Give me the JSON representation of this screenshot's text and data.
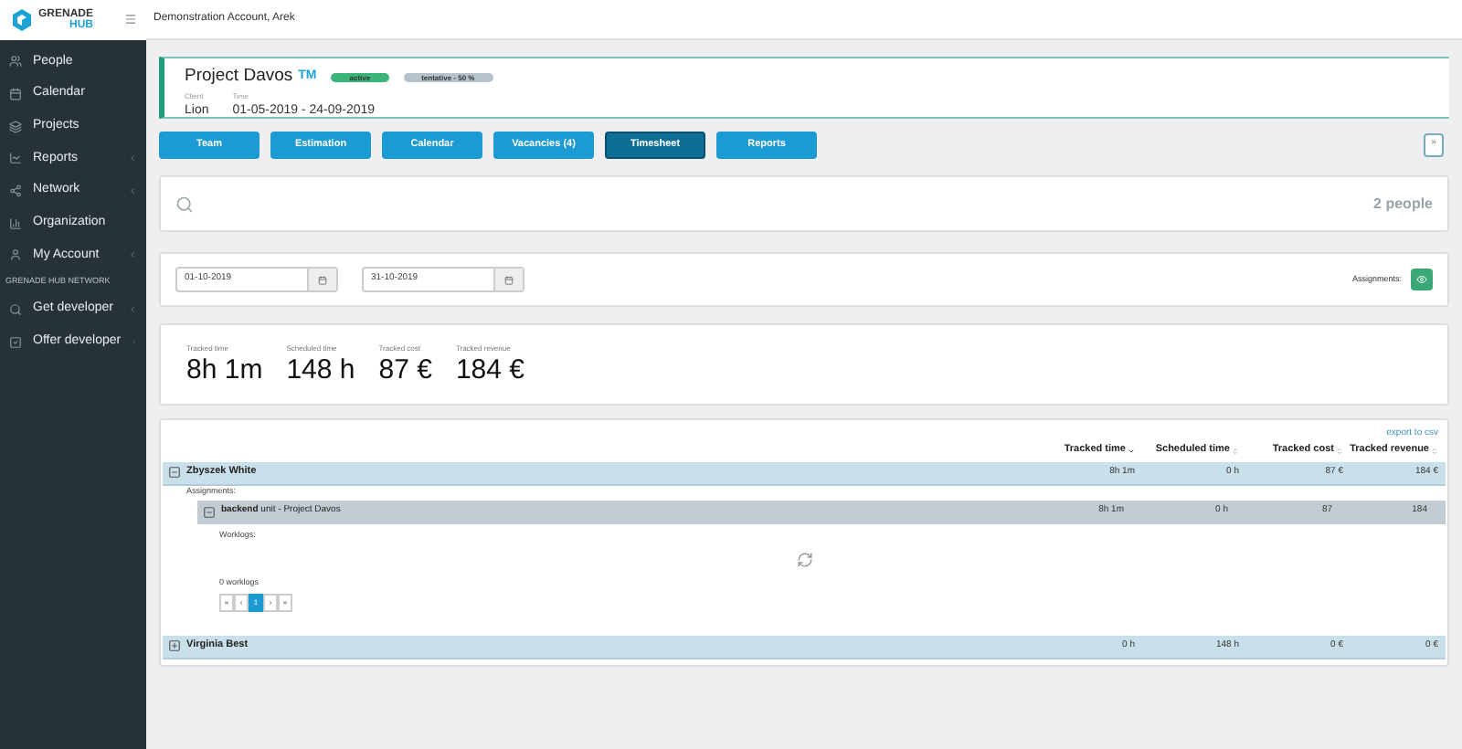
{
  "logo": {
    "line1": "GRENADE",
    "line2": "HUB"
  },
  "topbar": {
    "account": "Demonstration Account, Arek"
  },
  "sidebar": {
    "items": [
      {
        "label": "People",
        "submenu": false
      },
      {
        "label": "Calendar",
        "submenu": false
      },
      {
        "label": "Projects",
        "submenu": false
      },
      {
        "label": "Reports",
        "submenu": true
      },
      {
        "label": "Network",
        "submenu": true
      },
      {
        "label": "Organization",
        "submenu": false
      },
      {
        "label": "My Account",
        "submenu": true
      }
    ],
    "section_title": "GRENADE HUB NETWORK",
    "network_items": [
      {
        "label": "Get developer",
        "submenu": true
      },
      {
        "label": "Offer developer",
        "submenu": true
      }
    ]
  },
  "project": {
    "name": "Project Davos",
    "tag": "TM",
    "badges": [
      {
        "label": "active",
        "color": "#3bb57a"
      },
      {
        "label": "tentative - 50 %",
        "color": "#b7c2cb"
      }
    ],
    "client_label": "Client",
    "client": "Lion",
    "time_label": "Time",
    "time": "01-05-2019 - 24-09-2019"
  },
  "tabs": [
    {
      "label": "Team",
      "selected": false
    },
    {
      "label": "Estimation",
      "selected": false
    },
    {
      "label": "Calendar",
      "selected": false
    },
    {
      "label": "Vacancies (4)",
      "selected": false
    },
    {
      "label": "Timesheet",
      "selected": true
    },
    {
      "label": "Reports",
      "selected": false
    }
  ],
  "expand_button": "»",
  "search": {
    "count": "2 people"
  },
  "filters": {
    "from": "01-10-2019",
    "to": "31-10-2019",
    "assignments_label": "Assignments:"
  },
  "stats": [
    {
      "label": "Tracked time",
      "value": "8h 1m"
    },
    {
      "label": "Scheduled time",
      "value": "148 h"
    },
    {
      "label": "Tracked cost",
      "value": "87 €"
    },
    {
      "label": "Tracked revenue",
      "value": "184 €"
    }
  ],
  "table": {
    "export": "export to csv",
    "columns": [
      {
        "label": "Tracked time",
        "sorted": true
      },
      {
        "label": "Scheduled time",
        "sorted": false
      },
      {
        "label": "Tracked cost",
        "sorted": false
      },
      {
        "label": "Tracked revenue",
        "sorted": false
      }
    ],
    "rows": [
      {
        "name": "Zbyszek White",
        "expanded": true,
        "values": [
          "8h 1m",
          "0 h",
          "87 €",
          "184 €"
        ],
        "assignments_label": "Assignments:",
        "assignments": [
          {
            "title": "**backend** unit - Project Davos",
            "expanded": true,
            "values": [
              "8h 1m",
              "0 h",
              "87",
              "184"
            ],
            "worklogs_label": "Worklogs:",
            "worklogs_count": "0 worklogs",
            "pages": [
              {
                "label": "«",
                "selected": false
              },
              {
                "label": "‹",
                "selected": false
              },
              {
                "label": "1",
                "selected": true
              },
              {
                "label": "›",
                "selected": false
              },
              {
                "label": "»",
                "selected": false
              }
            ]
          }
        ]
      },
      {
        "name": "Virginia Best",
        "expanded": false,
        "values": [
          "0 h",
          "148 h",
          "0 €",
          "0 €"
        ]
      }
    ]
  }
}
